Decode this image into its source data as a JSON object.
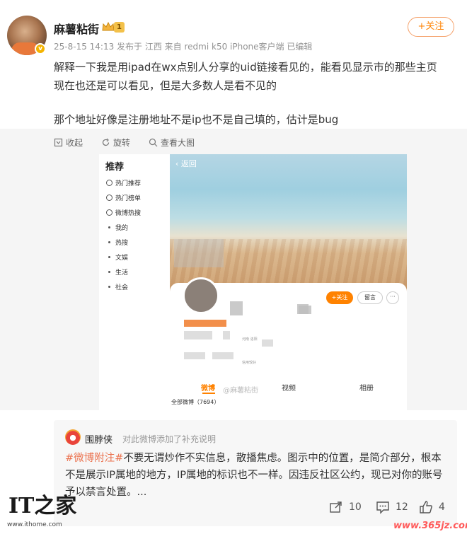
{
  "post": {
    "username": "麻薯粘街",
    "level_badge": "1",
    "follow_label": "+关注",
    "meta": "25-8-15 14:13 发布于 江西 来自 redmi k50 iPhone客户端 已编辑",
    "body_line_1": "解释一下我是用ipad在wx点别人分享的uid链接看见的，能看见显示市的那些主页",
    "body_line_2": "现在也还是可以看见，但是大多数人是看不见的",
    "body_line_3": "那个地址好像是注册地址不是ip也不是自己填的，估计是bug"
  },
  "image_toolbar": {
    "collapse": "收起",
    "rotate": "旋转",
    "view_large": "查看大图"
  },
  "screenshot": {
    "sidebar_title": "推荐",
    "sidebar_items": [
      "热门推荐",
      "热门榜单",
      "微博热搜",
      "我的",
      "热搜",
      "文娱",
      "生活",
      "社会"
    ],
    "back_label": "返回",
    "follow_label": "+关注",
    "message_label": "留言",
    "more_label": "···",
    "tabs": [
      "微博",
      "视频",
      "相册"
    ],
    "all_weibo_label": "全部微博（7694）",
    "watermark": "@麻薯粘街",
    "location_text": "河南 洛阳",
    "edu_text": "信用较好"
  },
  "notice": {
    "account_name": "围脖侠",
    "description": "对此微博添加了补充说明",
    "tag": "#微博附注#",
    "text": "不要无谓炒作不实信息，散播焦虑。图示中的位置，是简介部分，根本不是展示IP属地的地方，IP属地的标识也不一样。因违反社区公约，现已对你的账号予以禁言处置。..."
  },
  "stats": {
    "reposts": "10",
    "comments": "12",
    "likes": "4"
  },
  "branding": {
    "logo_text": "IT之家",
    "logo_url": "www.ithome.com",
    "right_watermark": "www.365jz.com"
  },
  "colors": {
    "accent_orange": "#ff8200",
    "tag_color": "#eb7350"
  }
}
